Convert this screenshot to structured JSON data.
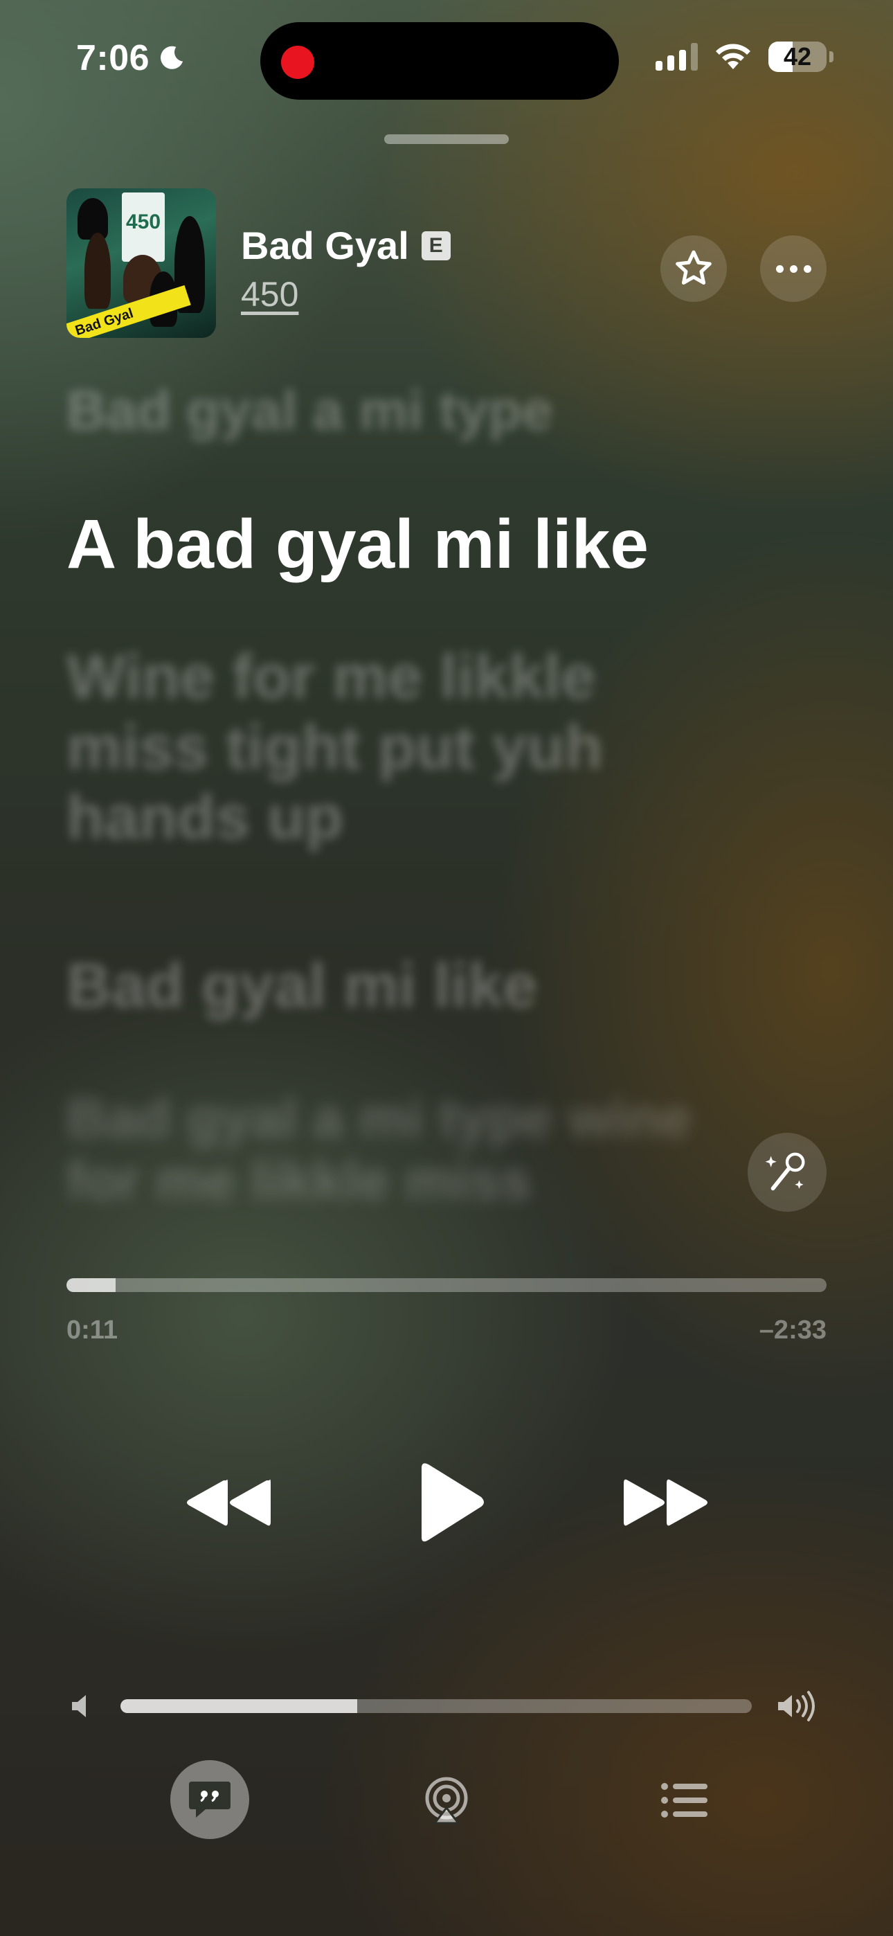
{
  "status_bar": {
    "time": "7:06",
    "battery_level": "42",
    "icons": [
      "moon-icon",
      "recording-indicator",
      "cellular-signal-icon",
      "wifi-icon",
      "battery-icon"
    ]
  },
  "now_playing": {
    "title": "Bad Gyal",
    "explicit_badge": "E",
    "artist": "450",
    "artwork_text": {
      "sign": "450",
      "tape": "Bad Gyal"
    }
  },
  "lyrics": {
    "previous": "Bad gyal a mi type",
    "current": "A bad gyal mi like",
    "next": "Wine for me likkle miss tight put yuh hands up",
    "next_2": "Bad gyal mi like",
    "next_3": "Bad gyal a mi type wine for me likkle miss"
  },
  "playback": {
    "elapsed": "0:11",
    "remaining": "–2:33",
    "progress_fraction": 0.065,
    "volume_fraction": 0.375
  },
  "controls": {
    "favorite_icon": "star-icon",
    "more_icon": "ellipsis-icon",
    "sing_icon": "microphone-sparkle-icon",
    "rewind_icon": "rewind-icon",
    "play_icon": "play-icon",
    "forward_icon": "fast-forward-icon",
    "lyrics_icon": "quote-bubble-icon",
    "airplay_icon": "airplay-icon",
    "queue_icon": "list-icon"
  },
  "colors": {
    "recording_red": "#e8141f",
    "text_primary": "#ffffff"
  }
}
